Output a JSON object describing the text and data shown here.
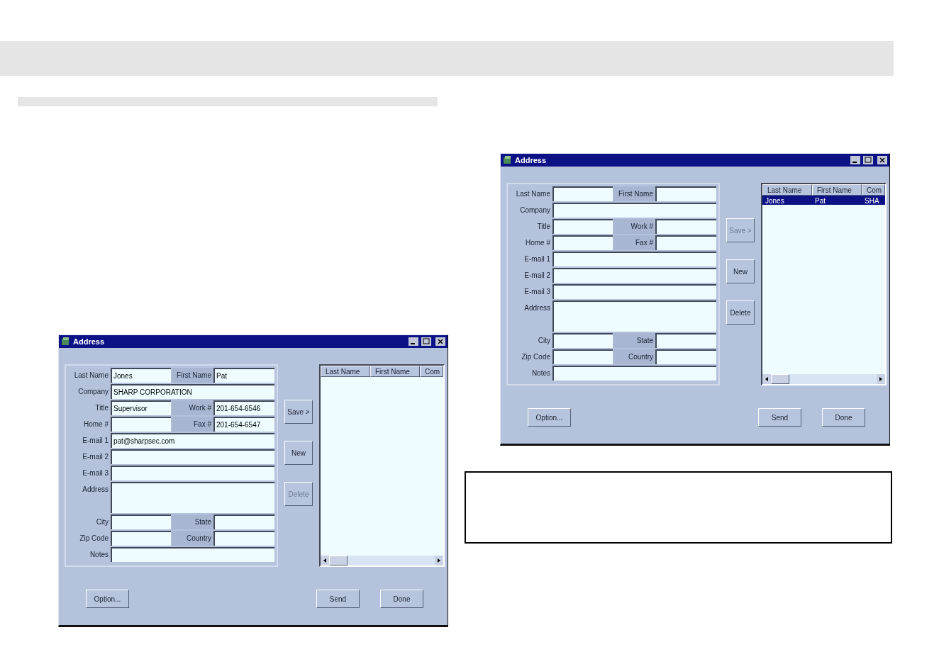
{
  "windows": [
    {
      "title": "Address",
      "form": [
        {
          "kind": "pair",
          "fields": [
            {
              "label": "Last Name",
              "value": "Jones"
            },
            {
              "label": "First Name",
              "value": "Pat"
            }
          ]
        },
        {
          "kind": "single",
          "fields": [
            {
              "label": "Company",
              "value": "SHARP CORPORATION"
            }
          ]
        },
        {
          "kind": "pair",
          "fields": [
            {
              "label": "Title",
              "value": "Supervisor"
            },
            {
              "label": "Work #",
              "value": "201-654-6546"
            }
          ]
        },
        {
          "kind": "pair",
          "fields": [
            {
              "label": "Home #"
            },
            {
              "label": "Fax #",
              "value": "201-654-6547"
            }
          ]
        },
        {
          "kind": "single",
          "fields": [
            {
              "label": "E-mail 1",
              "value": "pat@sharpsec.com"
            }
          ]
        },
        {
          "kind": "single",
          "fields": [
            {
              "label": "E-mail 2"
            }
          ]
        },
        {
          "kind": "single",
          "fields": [
            {
              "label": "E-mail 3"
            }
          ]
        },
        {
          "kind": "tall",
          "fields": [
            {
              "label": "Address"
            }
          ]
        },
        {
          "kind": "pair",
          "fields": [
            {
              "label": "City"
            },
            {
              "label": "State"
            }
          ]
        },
        {
          "kind": "pair",
          "fields": [
            {
              "label": "Zip Code"
            },
            {
              "label": "Country"
            }
          ]
        },
        {
          "kind": "single",
          "fields": [
            {
              "label": "Notes"
            }
          ]
        }
      ],
      "side_buttons": [
        {
          "label": "Save >",
          "disabled": false
        },
        {
          "label": "New",
          "disabled": false
        },
        {
          "label": "Delete",
          "disabled": true
        }
      ],
      "list": {
        "columns": [
          "Last Name",
          "First Name",
          "Com"
        ]
      },
      "bottom_buttons": [
        "Option...",
        "Send",
        "Done"
      ]
    },
    {
      "title": "Address",
      "form": [
        {
          "kind": "pair",
          "fields": [
            {
              "label": "Last Name"
            },
            {
              "label": "First Name"
            }
          ]
        },
        {
          "kind": "single",
          "fields": [
            {
              "label": "Company"
            }
          ]
        },
        {
          "kind": "pair",
          "fields": [
            {
              "label": "Title"
            },
            {
              "label": "Work #"
            }
          ]
        },
        {
          "kind": "pair",
          "fields": [
            {
              "label": "Home #"
            },
            {
              "label": "Fax #"
            }
          ]
        },
        {
          "kind": "single",
          "fields": [
            {
              "label": "E-mail 1"
            }
          ]
        },
        {
          "kind": "single",
          "fields": [
            {
              "label": "E-mail 2"
            }
          ]
        },
        {
          "kind": "single",
          "fields": [
            {
              "label": "E-mail 3"
            }
          ]
        },
        {
          "kind": "tall",
          "fields": [
            {
              "label": "Address"
            }
          ]
        },
        {
          "kind": "pair",
          "fields": [
            {
              "label": "City"
            },
            {
              "label": "State"
            }
          ]
        },
        {
          "kind": "pair",
          "fields": [
            {
              "label": "Zip Code"
            },
            {
              "label": "Country"
            }
          ]
        },
        {
          "kind": "single",
          "fields": [
            {
              "label": "Notes"
            }
          ]
        }
      ],
      "side_buttons": [
        {
          "label": "Save >",
          "disabled": true
        },
        {
          "label": "New",
          "disabled": false
        },
        {
          "label": "Delete",
          "disabled": false
        }
      ],
      "list": {
        "columns": [
          "Last Name",
          "First Name",
          "Com"
        ],
        "rows": [
          {
            "cells": [
              "Jones",
              "Pat",
              "SHA"
            ],
            "selected": true
          }
        ]
      },
      "bottom_buttons": [
        "Option...",
        "Send",
        "Done"
      ]
    }
  ]
}
